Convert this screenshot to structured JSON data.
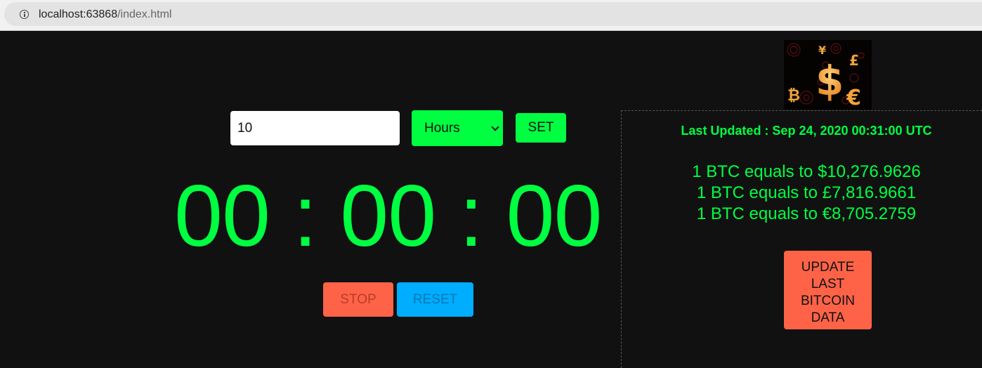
{
  "browser": {
    "url_host": "localhost:63868",
    "url_path": "/index.html"
  },
  "timer": {
    "input_value": "10",
    "unit_selected": "Hours",
    "set_label": "SET",
    "display": "00 : 00 : 00",
    "stop_label": "STOP",
    "reset_label": "RESET"
  },
  "bitcoin": {
    "last_updated": "Last Updated : Sep 24, 2020 00:31:00 UTC",
    "rates": [
      "1 BTC equals to $10,276.9626",
      "1 BTC equals to £7,816.9661",
      "1 BTC equals to €8,705.2759"
    ],
    "update_label_lines": [
      "UPDATE",
      "LAST",
      "BITCOIN",
      "DATA"
    ],
    "logo_glyphs": {
      "dollar": "$",
      "yen": "¥",
      "pound": "£",
      "euro": "€",
      "bitcoin": "₿"
    }
  },
  "colors": {
    "accent_green": "#00ff41",
    "stop_red": "#ff6347",
    "reset_blue": "#00adff",
    "background": "#111111"
  }
}
